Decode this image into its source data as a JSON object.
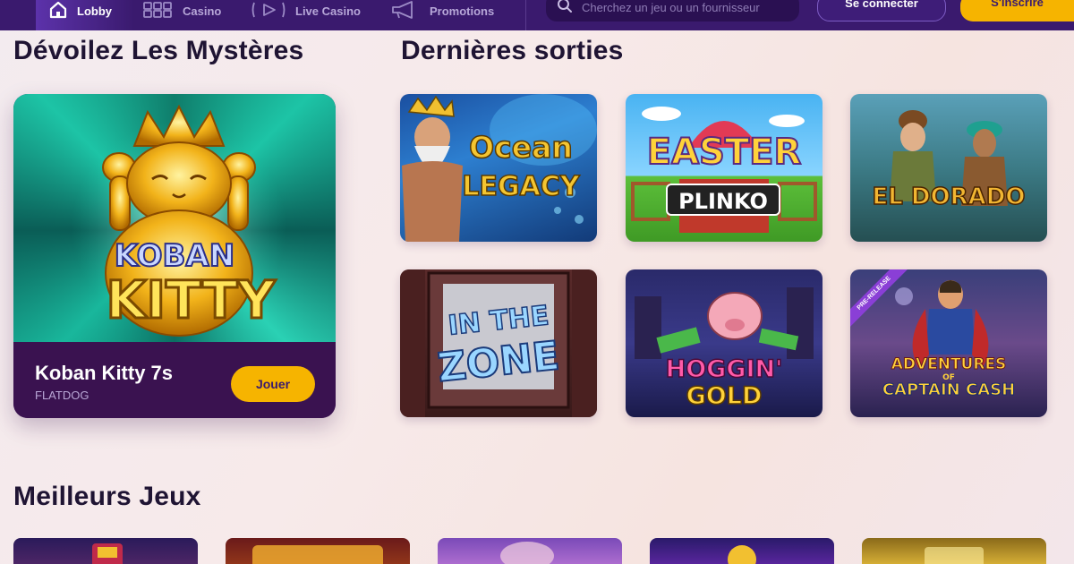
{
  "nav": {
    "items": [
      {
        "label": "Lobby",
        "icon": "home-icon",
        "active": true
      },
      {
        "label": "Casino",
        "icon": "grid-icon",
        "active": false
      },
      {
        "label": "Live Casino",
        "icon": "play-icon",
        "active": false
      },
      {
        "label": "Promotions",
        "icon": "megaphone-icon",
        "active": false
      }
    ],
    "search_placeholder": "Cherchez un jeu ou un fournisseur",
    "login_label": "Se connecter",
    "register_label": "S'inscrire"
  },
  "sections": {
    "mysteries_title": "Dévoilez Les Mystères",
    "latest_title": "Dernières sorties",
    "best_title": "Meilleurs Jeux"
  },
  "featured": {
    "art_text_line1": "KOBAN",
    "art_text_line2": "KITTY",
    "title": "Koban Kitty 7s",
    "provider": "FLATDOG",
    "play_label": "Jouer"
  },
  "latest_games": [
    {
      "line1": "Ocean",
      "line2": "LEGACY"
    },
    {
      "line1": "EASTER",
      "line2": "PLINKO"
    },
    {
      "line1": "EL DORADO",
      "line2": ""
    },
    {
      "line1": "IN THE",
      "line2": "ZONE"
    },
    {
      "line1": "HOGGIN'",
      "line2": "GOLD"
    },
    {
      "line1": "ADVENTURES",
      "line2": "CAPTAIN CASH",
      "connector": "OF",
      "badge": "PRE-RELEASE"
    }
  ],
  "colors": {
    "nav_bg": "#3a1a6e",
    "accent_yellow": "#f6b400",
    "card_purple": "#3a1250"
  }
}
